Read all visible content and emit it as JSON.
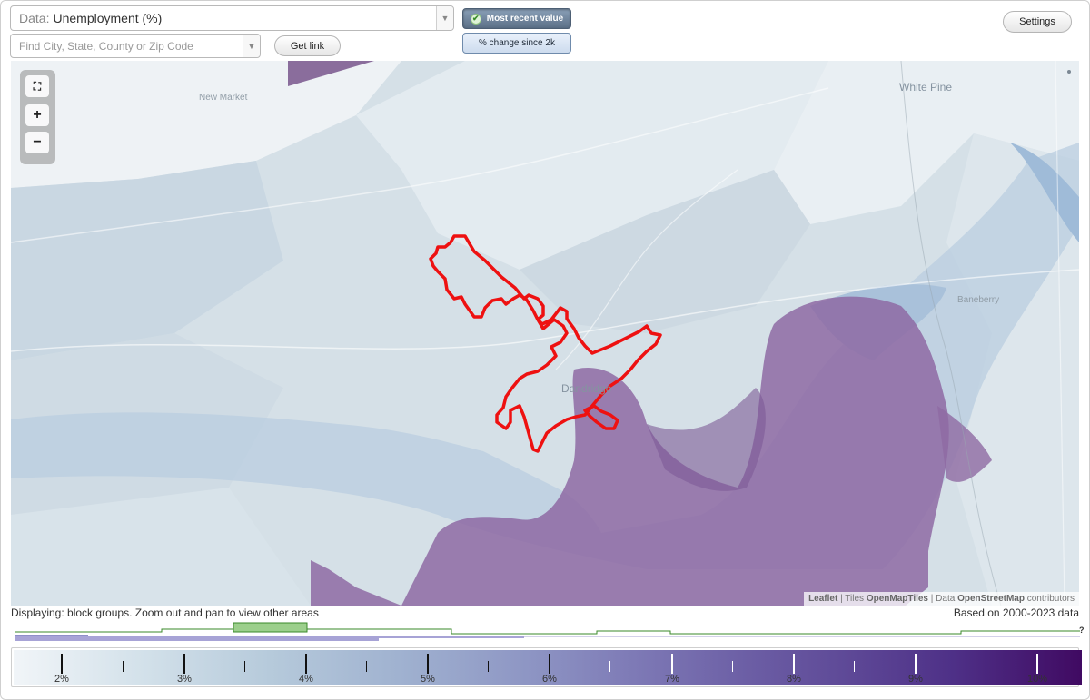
{
  "data_select": {
    "prefix": "Data:",
    "value": "Unemployment (%)"
  },
  "search": {
    "placeholder": "Find City, State, County or Zip Code"
  },
  "buttons": {
    "get_link": "Get link",
    "settings": "Settings"
  },
  "modes": {
    "most_recent": "Most recent value",
    "pct_change": "% change since 2k",
    "active": "most_recent"
  },
  "map": {
    "labels": {
      "new_market": "New Market",
      "white_pine": "White Pine",
      "baneberry": "Baneberry",
      "dandridge": "Dandridge"
    },
    "attribution": {
      "leaflet": "Leaflet",
      "tiles_prefix": "Tiles",
      "tiles": "OpenMapTiles",
      "data_prefix": "Data",
      "osm": "OpenStreetMap",
      "suffix": "contributors"
    },
    "highlight_color": "#ee1111"
  },
  "display_note": "Displaying: block groups. Zoom out and pan to view other areas",
  "data_range": "Based on 2000-2023 data",
  "histogram_help": "?",
  "legend": {
    "labels": [
      "2%",
      "3%",
      "4%",
      "5%",
      "6%",
      "7%",
      "8%",
      "9%",
      "10%"
    ],
    "colors": {
      "low": "#f1f5f8",
      "high": "#400a62"
    }
  }
}
